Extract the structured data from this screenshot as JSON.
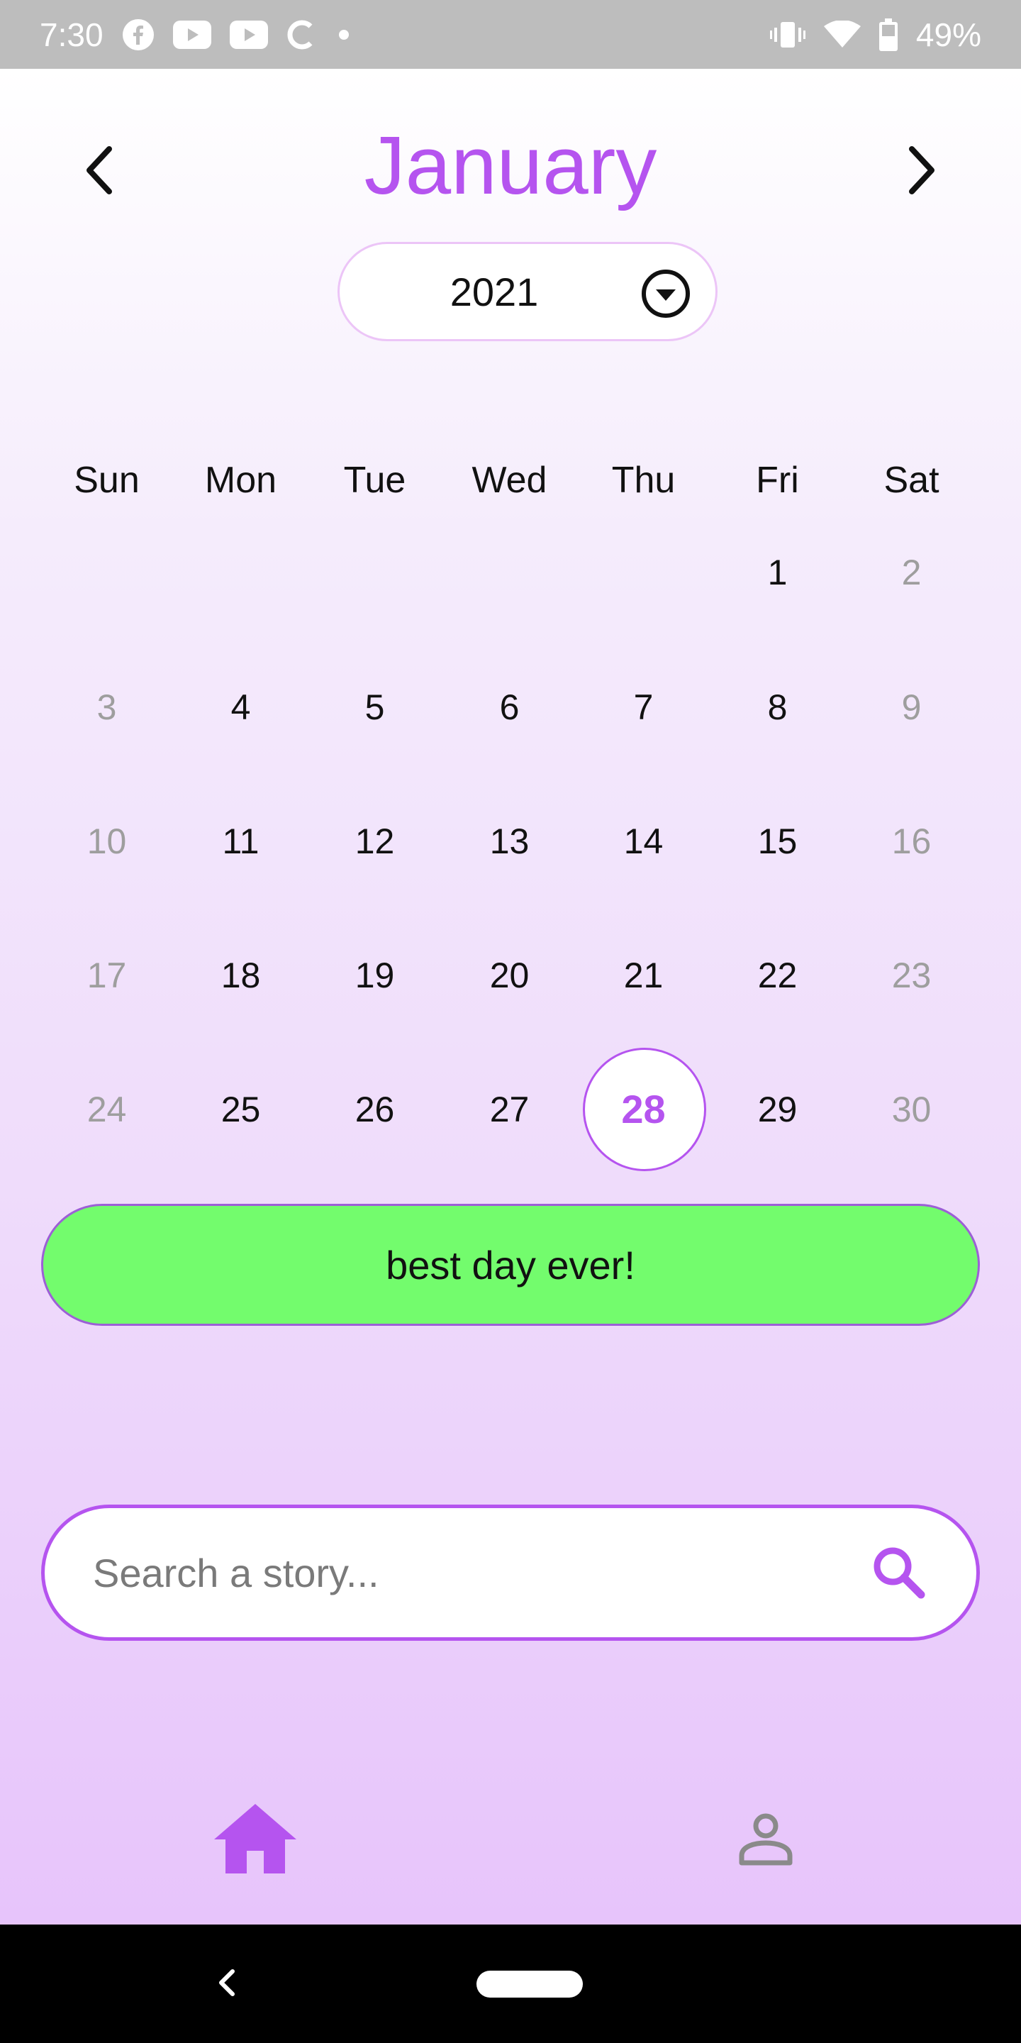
{
  "status_bar": {
    "time": "7:30",
    "notification_icons": [
      "facebook-icon",
      "youtube-icon",
      "youtube-icon",
      "c-app-icon",
      "dot-icon"
    ],
    "system_icons": [
      "vibrate-icon",
      "wifi-icon",
      "battery-icon"
    ],
    "battery": "49%"
  },
  "calendar": {
    "month": "January",
    "year": "2021",
    "weekdays": [
      "Sun",
      "Mon",
      "Tue",
      "Wed",
      "Thu",
      "Fri",
      "Sat"
    ],
    "selected_day": "28",
    "days": [
      "1",
      "2",
      "3",
      "4",
      "5",
      "6",
      "7",
      "8",
      "9",
      "10",
      "11",
      "12",
      "13",
      "14",
      "15",
      "16",
      "17",
      "18",
      "19",
      "20",
      "21",
      "22",
      "23",
      "24",
      "25",
      "26",
      "27",
      "28",
      "29",
      "30"
    ]
  },
  "mood": {
    "label": "best day ever!",
    "color": "#73fc6d"
  },
  "search": {
    "placeholder": "Search a story..."
  },
  "tabs": [
    {
      "icon": "home-icon",
      "active": true
    },
    {
      "icon": "profile-icon",
      "active": false
    }
  ],
  "colors": {
    "accent": "#b554ef",
    "inactive": "#8a8a8a",
    "weekend": "#9e9e9e"
  }
}
